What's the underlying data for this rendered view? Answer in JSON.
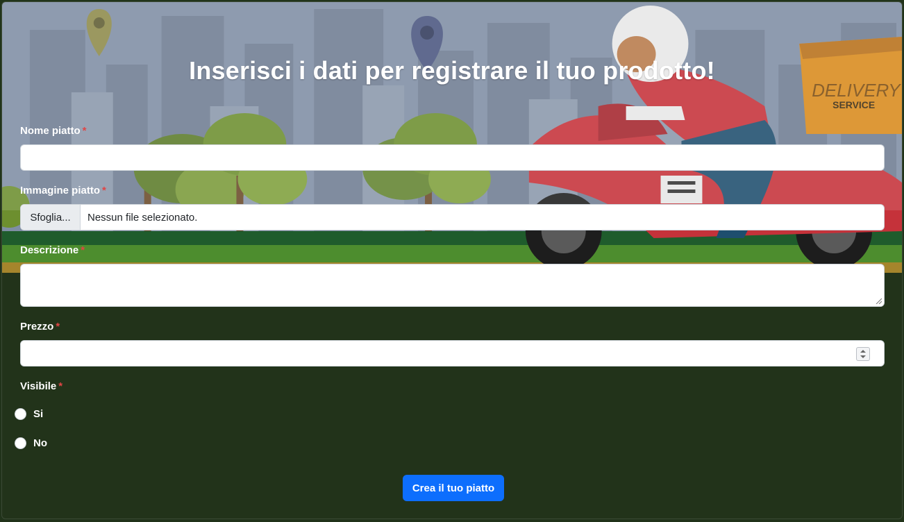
{
  "form": {
    "title": "Inserisci i dati per registrare il tuo prodotto!",
    "required_mark": "*",
    "fields": {
      "name": {
        "label": "Nome piatto",
        "value": ""
      },
      "image": {
        "label": "Immagine piatto",
        "button_label": "Sfoglia...",
        "status": "Nessun file selezionato."
      },
      "description": {
        "label": "Descrizione",
        "value": ""
      },
      "price": {
        "label": "Prezzo",
        "value": ""
      },
      "visible": {
        "label": "Visibile",
        "options": [
          "Si",
          "No"
        ]
      }
    },
    "submit_label": "Crea il tuo piatto"
  },
  "background": {
    "illustration_text": [
      "DELIVERY",
      "SERVICE"
    ],
    "colors": {
      "sky": "#7f8ea4",
      "grass": "#22331a",
      "accent": "#0d6efd",
      "box": "#d98a1c"
    }
  }
}
